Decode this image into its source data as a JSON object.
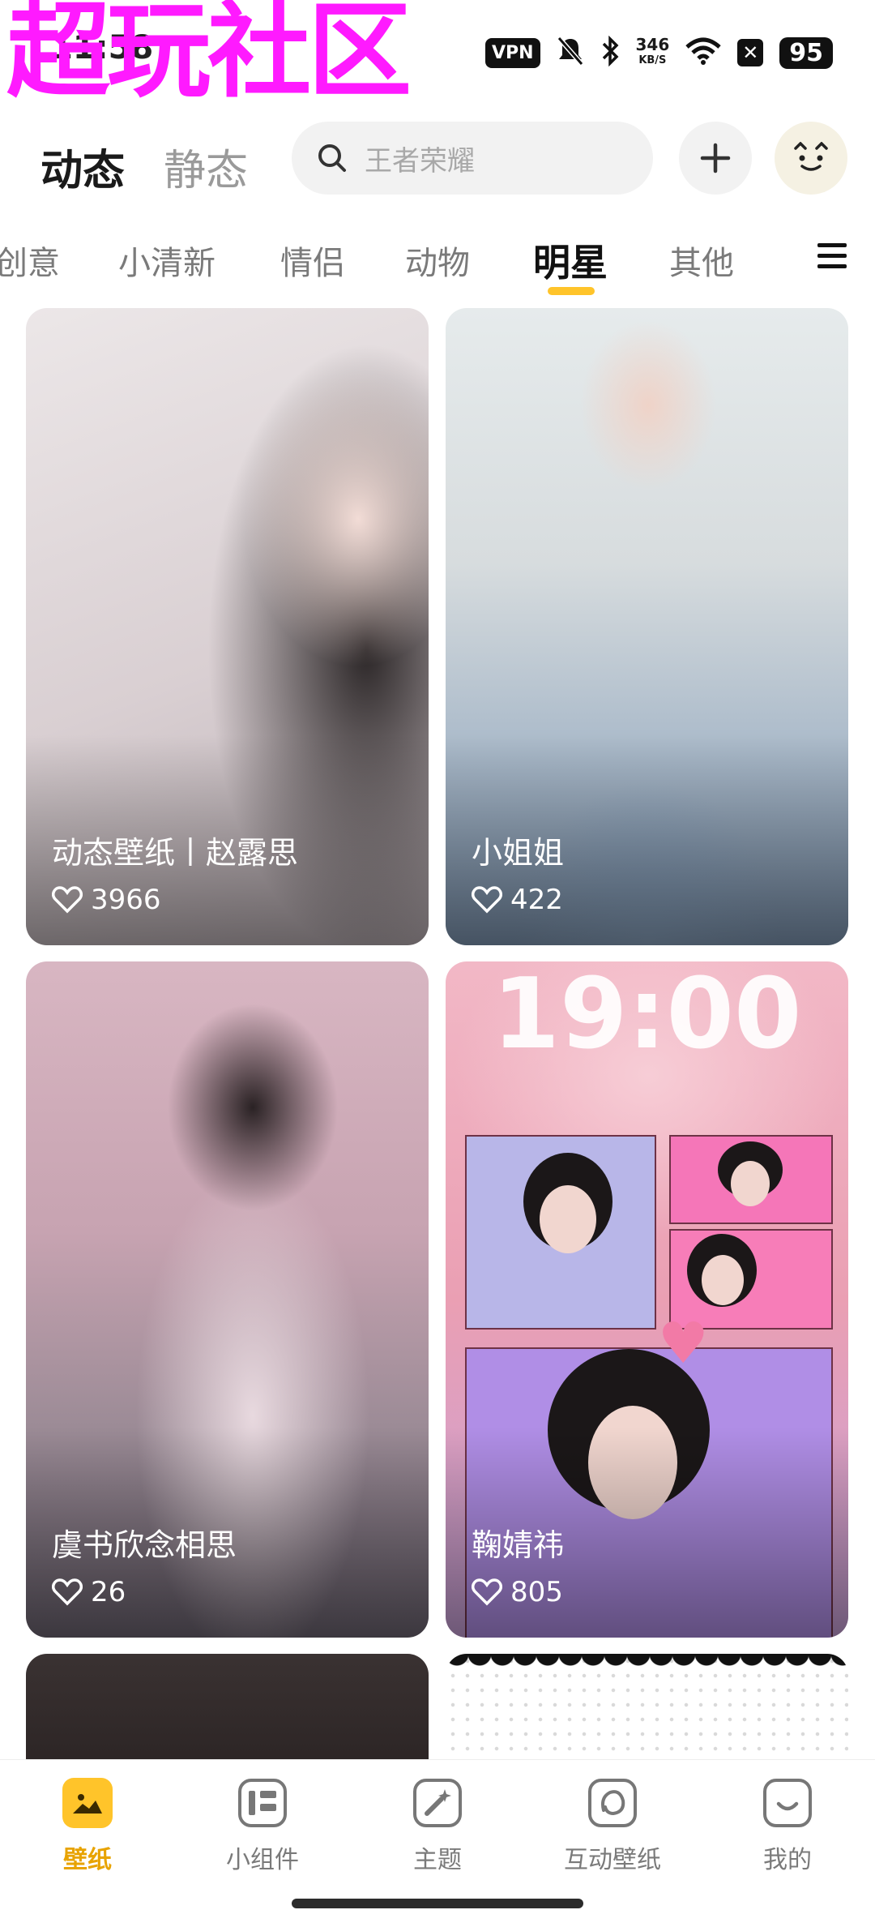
{
  "status_bar": {
    "watermark": "超玩社区",
    "time": "11:58",
    "vpn": "VPN",
    "speed_value": "346",
    "speed_unit": "KB/S",
    "battery": "95"
  },
  "header": {
    "tab_dynamic": "动态",
    "tab_static": "静态",
    "search_placeholder": "王者荣耀"
  },
  "categories": {
    "items": [
      "创意",
      "小清新",
      "情侣",
      "动物",
      "明星",
      "其他"
    ],
    "active": "明星"
  },
  "cards": [
    {
      "title": "动态壁纸丨赵露思",
      "likes": "3966"
    },
    {
      "title": "小姐姐",
      "likes": "422"
    },
    {
      "title": "虞书欣念相思",
      "likes": "26"
    },
    {
      "title": "鞠婧祎",
      "likes": "805",
      "clock": "19:00"
    }
  ],
  "bottom_nav": {
    "items": [
      "壁纸",
      "小组件",
      "主题",
      "互动壁纸",
      "我的"
    ],
    "active": "壁纸",
    "accent": "#ffc42a"
  }
}
